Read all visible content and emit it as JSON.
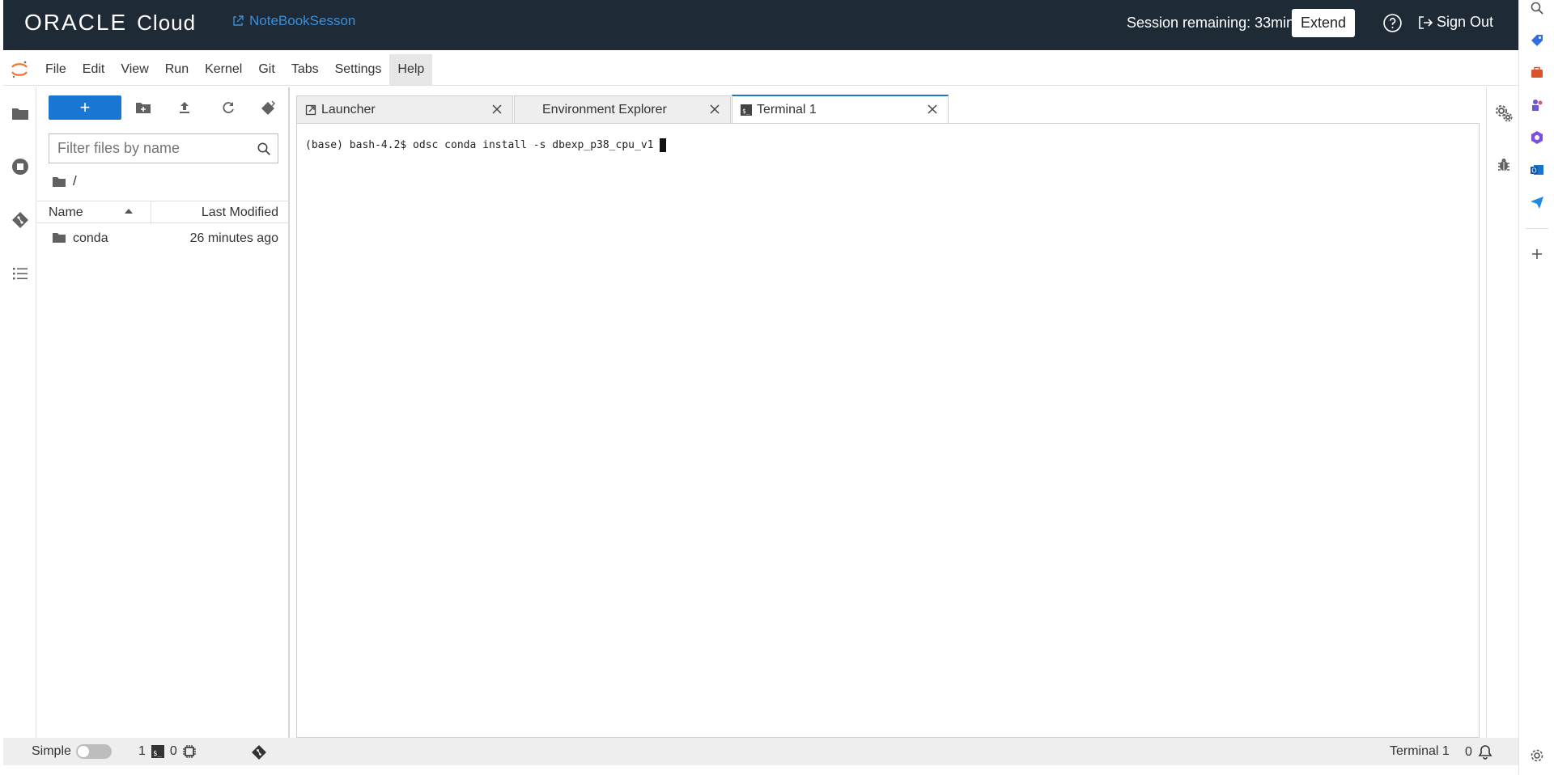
{
  "topbar": {
    "brand_oracle": "ORACLE",
    "brand_cloud": "Cloud",
    "notebook_link": "NoteBookSesson",
    "session_remaining": "Session remaining: 33min",
    "extend_label": "Extend",
    "signout_label": "Sign Out"
  },
  "menu": {
    "items": [
      "File",
      "Edit",
      "View",
      "Run",
      "Kernel",
      "Git",
      "Tabs",
      "Settings",
      "Help"
    ]
  },
  "filebrowser": {
    "new_label": "+",
    "filter_placeholder": "Filter files by name",
    "breadcrumb": "/",
    "col_name": "Name",
    "col_modified": "Last Modified",
    "files": [
      {
        "name": "conda",
        "modified": "26 minutes ago",
        "type": "folder"
      }
    ]
  },
  "tabs": [
    {
      "label": "Launcher",
      "icon": "external-link-icon",
      "active": false
    },
    {
      "label": "Environment Explorer",
      "icon": "",
      "active": false
    },
    {
      "label": "Terminal 1",
      "icon": "terminal-icon",
      "active": true
    }
  ],
  "terminal": {
    "line": "(base) bash-4.2$ odsc conda install -s dbexp_p38_cpu_v1"
  },
  "statusbar": {
    "mode_label": "Simple",
    "terminals_count": "1",
    "kernels_count": "0",
    "active_item": "Terminal 1",
    "notifications_count": "0"
  },
  "colors": {
    "topbar_bg": "#1f2a37",
    "accent": "#1976d2",
    "link": "#3d8fd6",
    "jupyter_orange": "#f37726"
  }
}
